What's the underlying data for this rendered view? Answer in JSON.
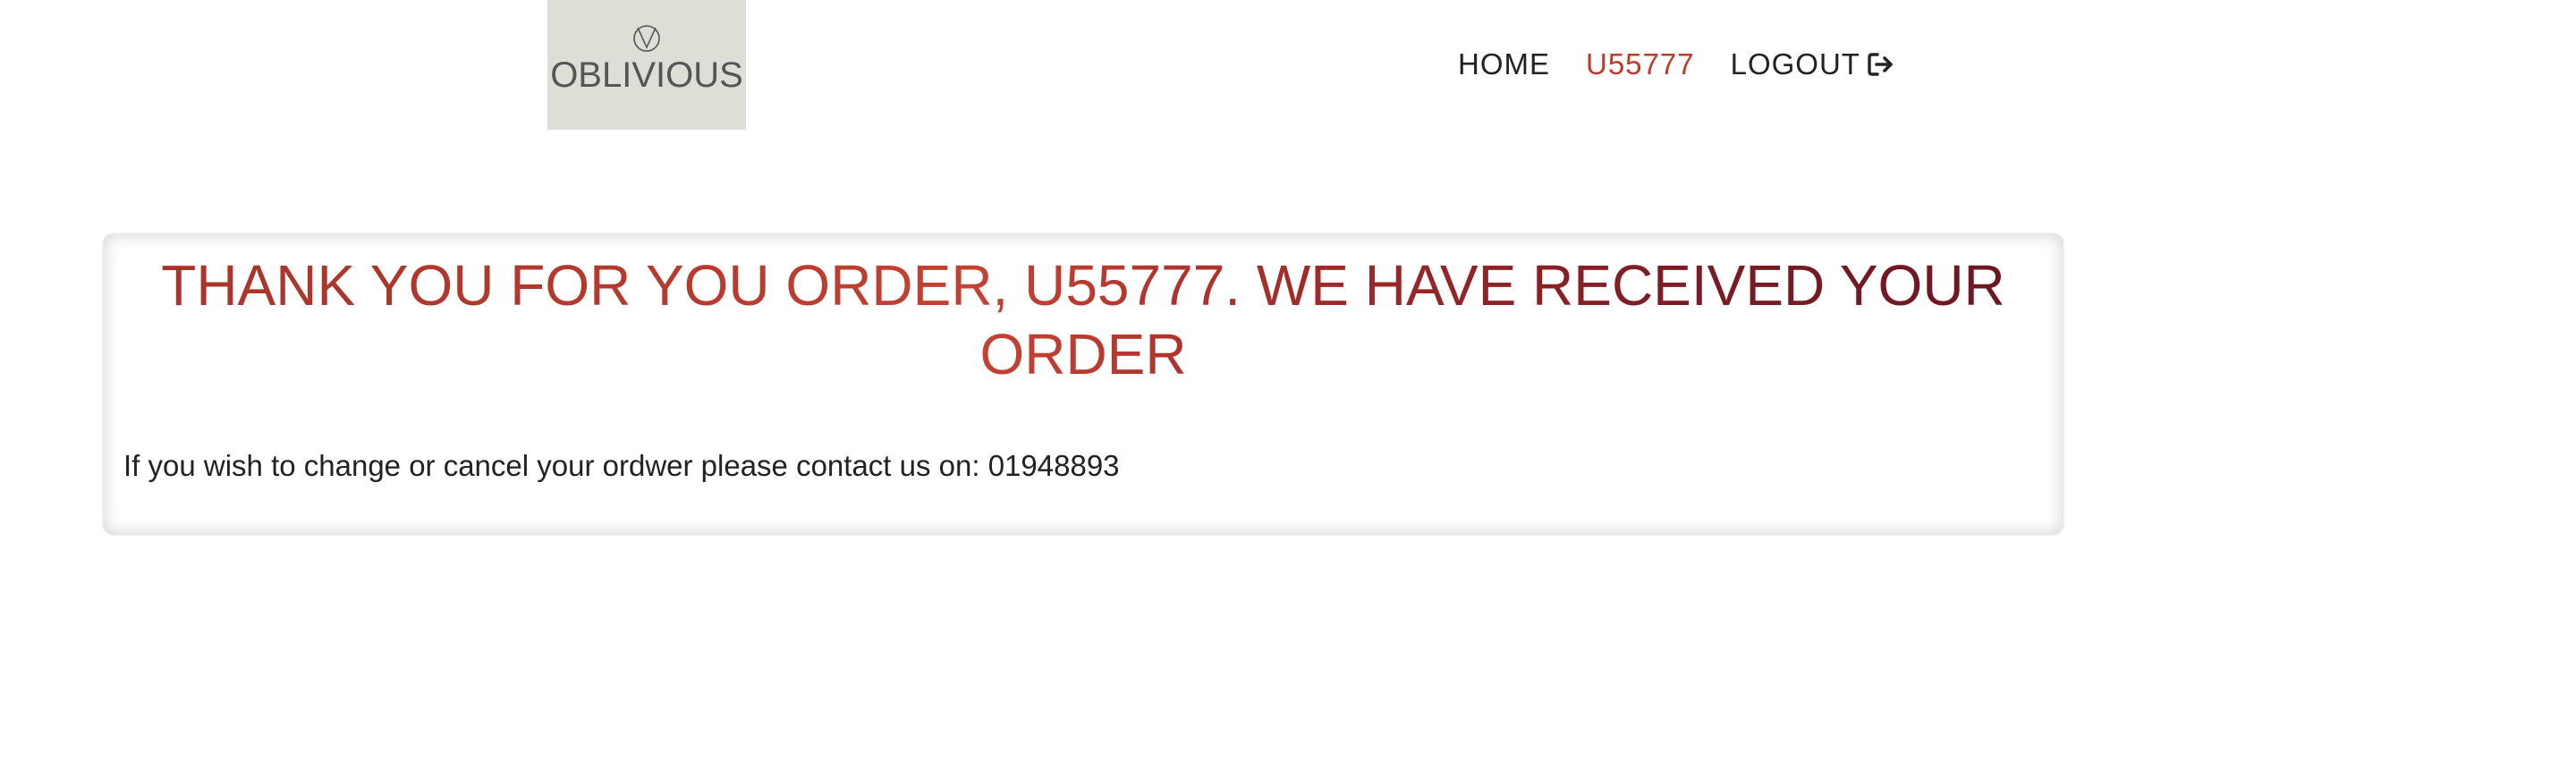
{
  "brand": {
    "logo_text": "OBLIVIOUS",
    "logo_bg": "#deded6",
    "logo_mark_icon": "v-circle-logo-icon"
  },
  "nav": {
    "home_label": "HOME",
    "user_label": "U55777",
    "logout_label": "LOGOUT",
    "logout_icon": "sign-out-icon",
    "accent_color": "#c0392b"
  },
  "confirmation": {
    "title": "THANK YOU FOR YOU ORDER, U55777. WE HAVE RECEIVED YOUR ORDER",
    "message": "If you wish to change or cancel your ordwer please contact us on: 01948893"
  }
}
